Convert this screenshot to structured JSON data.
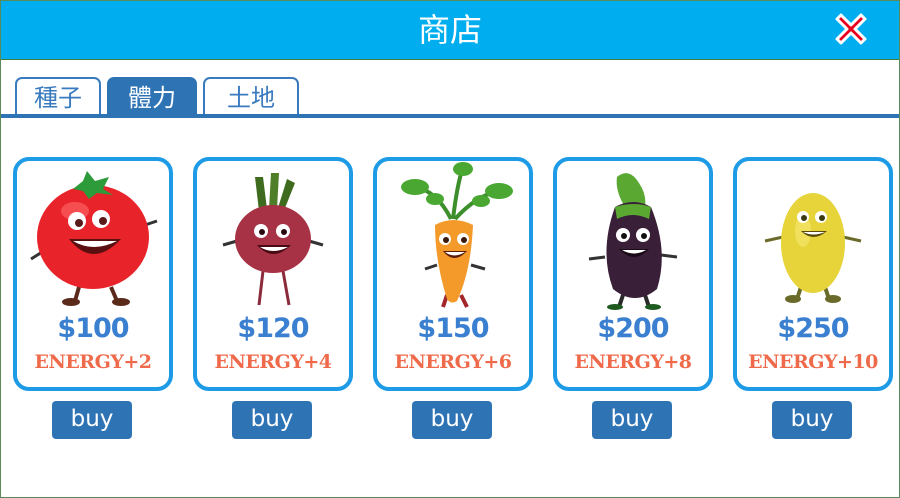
{
  "shop": {
    "title": "商店",
    "tabs": [
      {
        "label": "種子",
        "active": false
      },
      {
        "label": "體力",
        "active": true
      },
      {
        "label": "土地",
        "active": false
      }
    ],
    "close_icon": "close-x-icon",
    "items": [
      {
        "vegetable": "tomato-icon",
        "price": "$100",
        "energy": "ENERGY+2",
        "buy_label": "buy"
      },
      {
        "vegetable": "beet-icon",
        "price": "$120",
        "energy": "ENERGY+4",
        "buy_label": "buy"
      },
      {
        "vegetable": "carrot-icon",
        "price": "$150",
        "energy": "ENERGY+6",
        "buy_label": "buy"
      },
      {
        "vegetable": "eggplant-icon",
        "price": "$200",
        "energy": "ENERGY+8",
        "buy_label": "buy"
      },
      {
        "vegetable": "potato-icon",
        "price": "$250",
        "energy": "ENERGY+10",
        "buy_label": "buy"
      }
    ]
  },
  "colors": {
    "titlebar": "#00aeef",
    "tab_active": "#2e74b5",
    "card_border": "#1e9be6",
    "price": "#3b7fd0",
    "energy": "#ef6a4a",
    "close": "#e8001c"
  }
}
